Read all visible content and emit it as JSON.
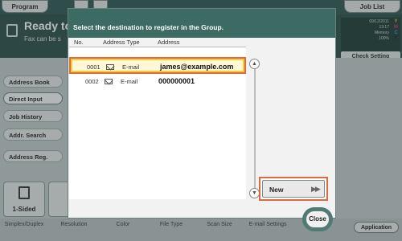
{
  "background": {
    "top_tabs": [
      "Program",
      "",
      "",
      "Job List"
    ],
    "title": "Ready to",
    "subtitle": "Fax can be s",
    "status": {
      "date": "09/12/2011",
      "time": "13:17",
      "memory_label": "Memory",
      "memory_value": "100%",
      "toner": [
        "Y",
        "M",
        "C",
        "K"
      ]
    },
    "check_setting": "Check Setting",
    "left_menu": [
      "Address Book",
      "Direct Input",
      "Job History",
      "Addr. Search",
      "Address Reg."
    ],
    "sided_label": "1-Sided",
    "bottom_labels": [
      "Simplex/Duplex",
      "Resolution",
      "Color",
      "File Type",
      "Scan Size",
      "E-mail Settings"
    ],
    "application": "Application",
    "toner_colors": {
      "Y": "#e6c400",
      "M": "#d0307a",
      "C": "#1aa0d8",
      "K": "#222222"
    }
  },
  "dialog": {
    "title": "Select the destination to register in the Group.",
    "columns": [
      "No.",
      "Address Type",
      "Address"
    ],
    "rows": [
      {
        "no": "0001",
        "type": "E-mail",
        "address": "james@example.com",
        "selected": true
      },
      {
        "no": "0002",
        "type": "E-mail",
        "address": "000000001",
        "selected": false
      }
    ],
    "new_button": "New",
    "close_button": "Close"
  }
}
